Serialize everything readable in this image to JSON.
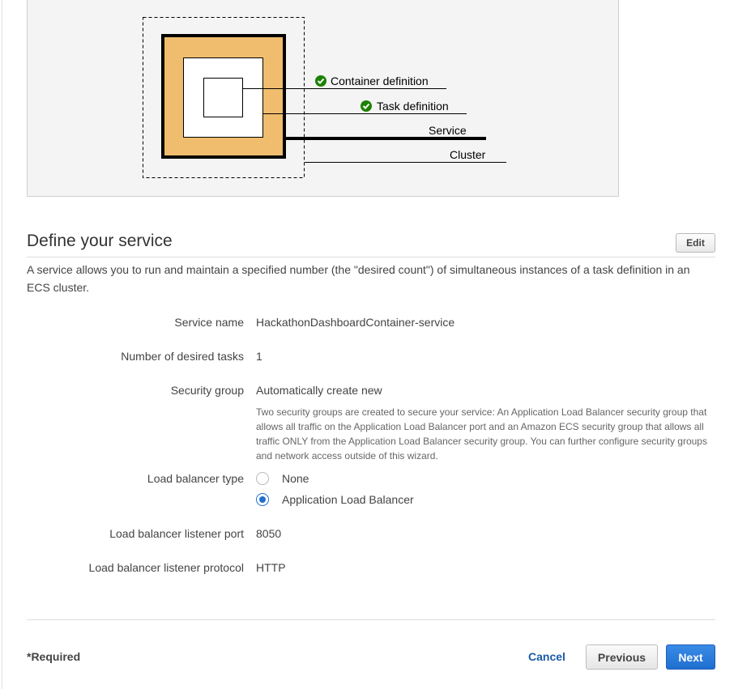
{
  "diagram": {
    "labels": {
      "container_definition": "Container definition",
      "task_definition": "Task definition",
      "service": "Service",
      "cluster": "Cluster"
    }
  },
  "section": {
    "title": "Define your service",
    "edit_label": "Edit",
    "description": "A service allows you to run and maintain a specified number (the \"desired count\") of simultaneous instances of a task definition in an ECS cluster."
  },
  "fields": {
    "service_name": {
      "label": "Service name",
      "value": "HackathonDashboardContainer-service"
    },
    "desired_tasks": {
      "label": "Number of desired tasks",
      "value": "1"
    },
    "security_group": {
      "label": "Security group",
      "value": "Automatically create new",
      "help": "Two security groups are created to secure your service: An Application Load Balancer security group that allows all traffic on the Application Load Balancer port and an Amazon ECS security group that allows all traffic ONLY from the Application Load Balancer security group. You can further configure security groups and network access outside of this wizard."
    },
    "load_balancer_type": {
      "label": "Load balancer type",
      "options": [
        "None",
        "Application Load Balancer"
      ],
      "selected": "Application Load Balancer"
    },
    "listener_port": {
      "label": "Load balancer listener port",
      "value": "8050"
    },
    "listener_protocol": {
      "label": "Load balancer listener protocol",
      "value": "HTTP"
    }
  },
  "footer": {
    "required_note": "*Required",
    "cancel_label": "Cancel",
    "previous_label": "Previous",
    "next_label": "Next"
  },
  "colors": {
    "accent": "#1f6fd0",
    "link": "#1a5aa6",
    "check_green": "#1d8102",
    "cluster_fill": "#f0bd6e"
  }
}
